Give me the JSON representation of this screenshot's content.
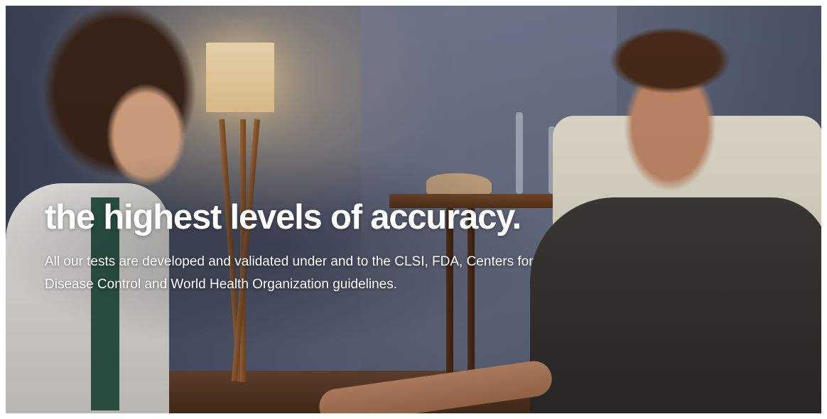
{
  "hero": {
    "headline": "the highest levels of accuracy.",
    "body": "All our tests are developed and validated under and to the CLSI, FDA, Centers for Disease Control and World Health Organization guidelines.",
    "image": {
      "depicts": "doctor-with-patient-photo"
    }
  }
}
